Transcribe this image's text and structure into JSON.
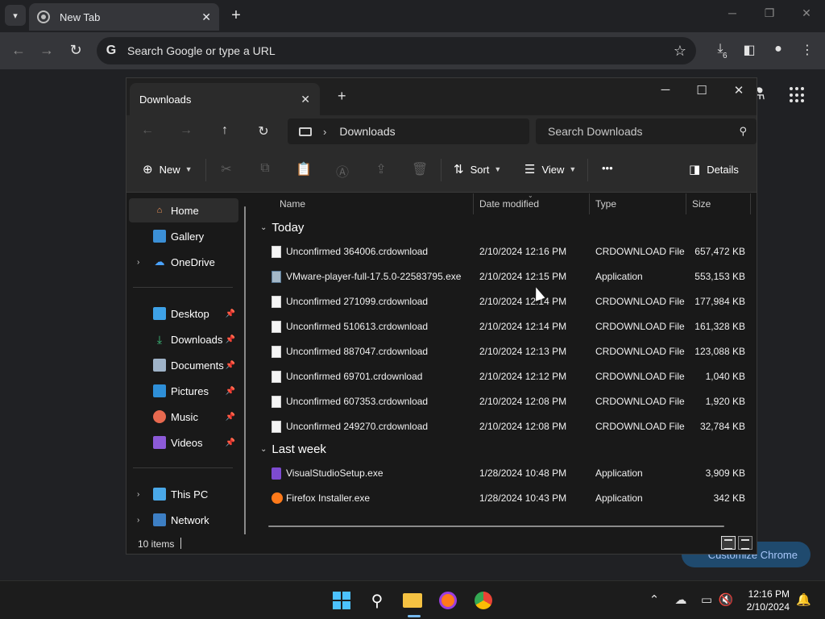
{
  "chrome": {
    "tab_title": "New Tab",
    "omnibox_placeholder": "Search Google or type a URL",
    "downloads_badge": "6",
    "customize_label": "Customize Chrome"
  },
  "explorer": {
    "tab_title": "Downloads",
    "address": {
      "path": "Downloads"
    },
    "search_placeholder": "Search Downloads",
    "commands": {
      "new_label": "New",
      "sort_label": "Sort",
      "view_label": "View",
      "more_label": "•••",
      "details_label": "Details"
    },
    "nav": {
      "home": "Home",
      "gallery": "Gallery",
      "onedrive": "OneDrive",
      "desktop": "Desktop",
      "downloads": "Downloads",
      "documents": "Documents",
      "pictures": "Pictures",
      "music": "Music",
      "videos": "Videos",
      "this_pc": "This PC",
      "network": "Network"
    },
    "columns": {
      "name": "Name",
      "date": "Date modified",
      "type": "Type",
      "size": "Size"
    },
    "groups": {
      "today": "Today",
      "last_week": "Last week"
    },
    "files": [
      {
        "name": "Unconfirmed 364006.crdownload",
        "date": "2/10/2024 12:16 PM",
        "type": "CRDOWNLOAD File",
        "size": "657,472 KB",
        "icon": "doc"
      },
      {
        "name": "VMware-player-full-17.5.0-22583795.exe",
        "date": "2/10/2024 12:15 PM",
        "type": "Application",
        "size": "553,153 KB",
        "icon": "vm"
      },
      {
        "name": "Unconfirmed 271099.crdownload",
        "date": "2/10/2024 12:14 PM",
        "type": "CRDOWNLOAD File",
        "size": "177,984 KB",
        "icon": "doc"
      },
      {
        "name": "Unconfirmed 510613.crdownload",
        "date": "2/10/2024 12:14 PM",
        "type": "CRDOWNLOAD File",
        "size": "161,328 KB",
        "icon": "doc"
      },
      {
        "name": "Unconfirmed 887047.crdownload",
        "date": "2/10/2024 12:13 PM",
        "type": "CRDOWNLOAD File",
        "size": "123,088 KB",
        "icon": "doc"
      },
      {
        "name": "Unconfirmed 69701.crdownload",
        "date": "2/10/2024 12:12 PM",
        "type": "CRDOWNLOAD File",
        "size": "1,040 KB",
        "icon": "doc"
      },
      {
        "name": "Unconfirmed 607353.crdownload",
        "date": "2/10/2024 12:08 PM",
        "type": "CRDOWNLOAD File",
        "size": "1,920 KB",
        "icon": "doc"
      },
      {
        "name": "Unconfirmed 249270.crdownload",
        "date": "2/10/2024 12:08 PM",
        "type": "CRDOWNLOAD File",
        "size": "32,784 KB",
        "icon": "doc"
      },
      {
        "name": "VisualStudioSetup.exe",
        "date": "1/28/2024 10:48 PM",
        "type": "Application",
        "size": "3,909 KB",
        "icon": "vs"
      },
      {
        "name": "Firefox Installer.exe",
        "date": "1/28/2024 10:43 PM",
        "type": "Application",
        "size": "342 KB",
        "icon": "ff"
      }
    ],
    "status_count": "10 items"
  },
  "taskbar": {
    "time": "12:16 PM",
    "date": "2/10/2024"
  },
  "colors": {
    "accent": "#4cc2ff",
    "customize_bg": "#1f4a6e"
  }
}
